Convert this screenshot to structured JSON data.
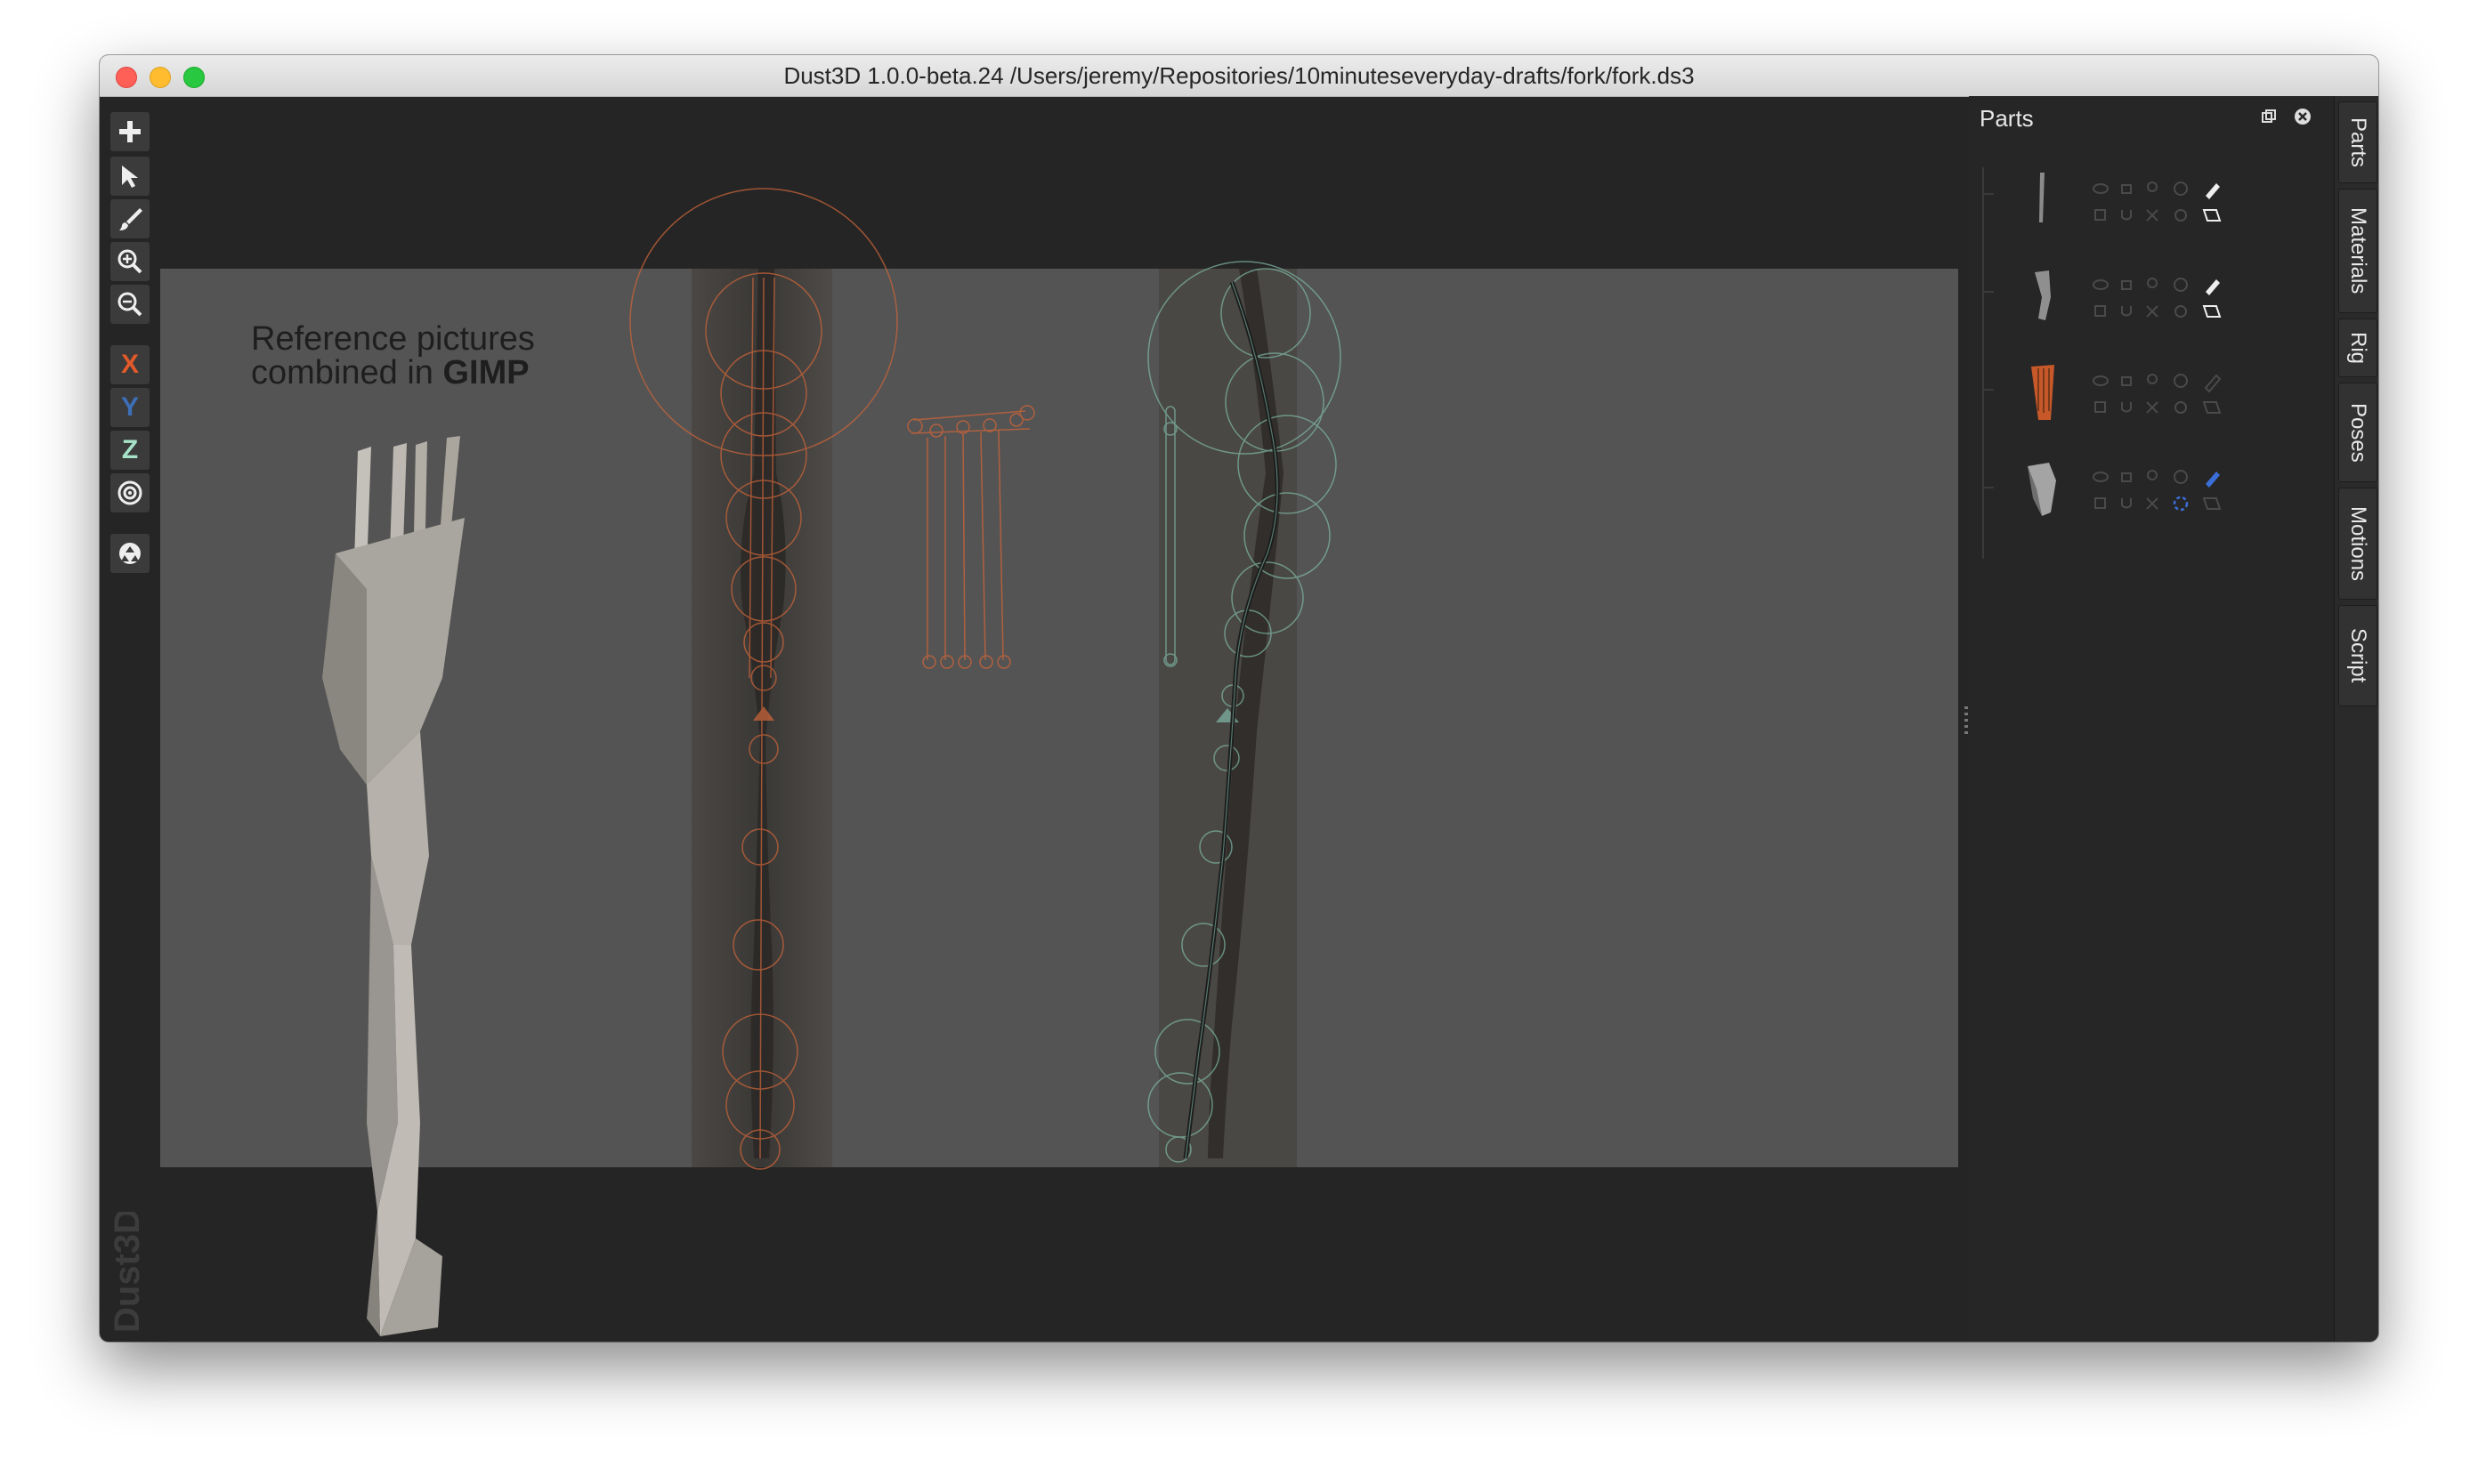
{
  "window": {
    "title": "Dust3D 1.0.0-beta.24 /Users/jeremy/Repositories/10minuteseveryday-drafts/fork/fork.ds3",
    "traffic_lights": [
      "close",
      "minimize",
      "zoom"
    ],
    "colors": {
      "close": "#fe5f57",
      "minimize": "#febc2e",
      "zoom": "#28c840"
    }
  },
  "toolbar": {
    "tools": [
      {
        "icon": "plus-icon"
      },
      {
        "icon": "pointer-icon"
      },
      {
        "icon": "brush-icon"
      },
      {
        "icon": "zoom-in-icon"
      },
      {
        "icon": "zoom-out-icon"
      }
    ],
    "axes": [
      {
        "label": "X",
        "color": "#e35a2a"
      },
      {
        "label": "Y",
        "color": "#3d6fb8"
      },
      {
        "label": "Z",
        "color": "#a7e3c8"
      }
    ],
    "extra": [
      {
        "icon": "target-icon"
      },
      {
        "icon": "recycle-icon"
      }
    ]
  },
  "viewport": {
    "annotation": {
      "line1": "Reference pictures",
      "line2_prefix": "combined in ",
      "line2_bold": "GIMP"
    },
    "watermark": "Dust3D",
    "colors": {
      "front_view_nodes": "#c8643a",
      "side_view_nodes": "#7fb8a6",
      "model": "#a9a69f"
    }
  },
  "parts_panel": {
    "title": "Parts",
    "rows": [
      {
        "thumb": "thin-rod-part",
        "color": "#8a8a8a",
        "edit_active": false
      },
      {
        "thumb": "curved-handle-part",
        "color": "#8f8f8f",
        "edit_active": false
      },
      {
        "thumb": "tines-part",
        "color": "#c6582a",
        "edit_active": false
      },
      {
        "thumb": "head-part",
        "color": "#a4a4a4",
        "edit_active": true
      }
    ]
  },
  "side_tabs": [
    "Parts",
    "Materials",
    "Rig",
    "Poses",
    "Motions",
    "Script"
  ]
}
